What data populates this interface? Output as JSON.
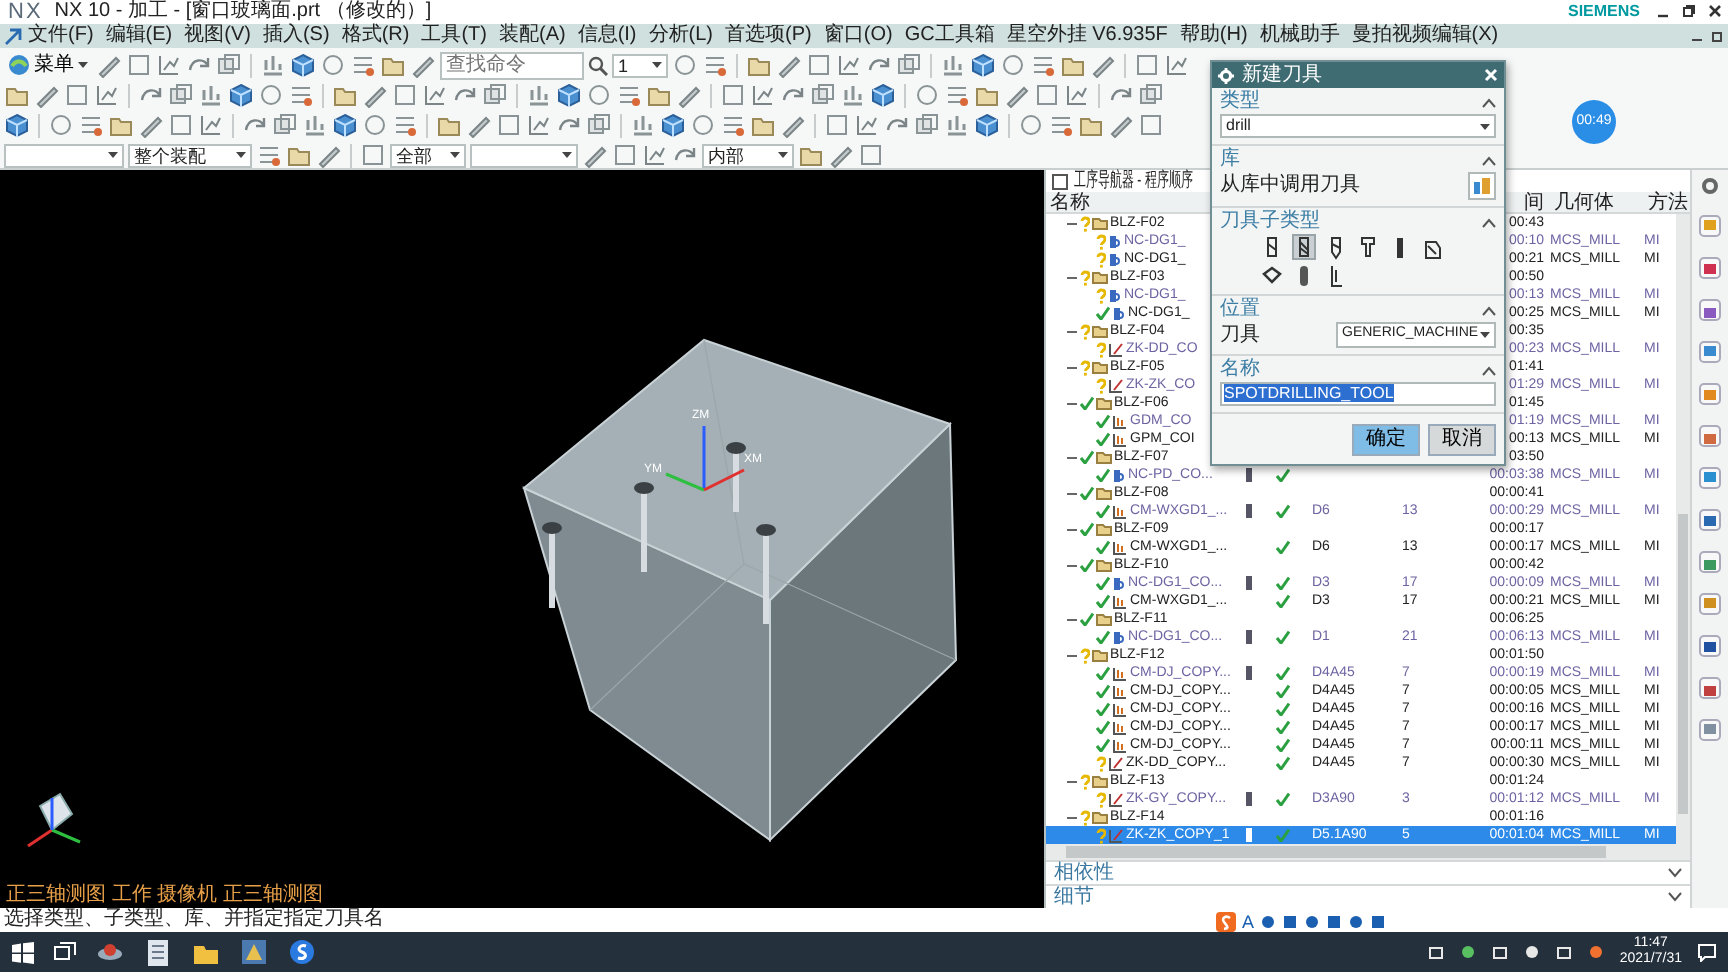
{
  "window": {
    "logo": "NX",
    "title": "NX 10 - 加工 - [窗口玻璃面.prt （修改的）]",
    "vendor": "SIEMENS"
  },
  "menu": [
    "文件(F)",
    "编辑(E)",
    "视图(V)",
    "插入(S)",
    "格式(R)",
    "工具(T)",
    "装配(A)",
    "信息(I)",
    "分析(L)",
    "首选项(P)",
    "窗口(O)",
    "GC工具箱",
    "星空外挂 V6.935F",
    "帮助(H)",
    "机械助手",
    "曼拍视频编辑(X)"
  ],
  "toolbar": {
    "menu_button": "菜单",
    "search_placeholder": "查找命令",
    "layer": "1"
  },
  "selection_bar": {
    "assembly_scope": "整个装配",
    "filter": "全部",
    "snap": "内部"
  },
  "timer": "00:49",
  "viewport": {
    "axis_labels": [
      "ZM",
      "YM",
      "XM"
    ],
    "view_label": "正三轴测图 工作 摄像机 正三轴测图"
  },
  "navigator": {
    "title": "工序导航器 - 程序顺序",
    "columns": {
      "name": "名称",
      "time": "间",
      "geometry": "几何体",
      "method": "方法"
    },
    "groups": [
      {
        "name": "BLZ-F02",
        "needs_regeneration": true,
        "time": "00:43",
        "expanded": true,
        "selected": false,
        "children": [
          {
            "kind": "nc",
            "name": "NC-DG1_",
            "needs_regeneration": true,
            "dimmed": true,
            "time": "00:10",
            "geometry": "MCS_MILL",
            "method": "MI",
            "selected": false
          },
          {
            "kind": "nc",
            "name": "NC-DG1_",
            "needs_regeneration": true,
            "dimmed": false,
            "time": "00:21",
            "geometry": "MCS_MILL",
            "method": "MI",
            "selected": false
          }
        ]
      },
      {
        "name": "BLZ-F03",
        "needs_regeneration": true,
        "time": "00:50",
        "expanded": true,
        "selected": false,
        "children": [
          {
            "kind": "nc",
            "name": "NC-DG1_",
            "needs_regeneration": true,
            "dimmed": true,
            "time": "00:13",
            "geometry": "MCS_MILL",
            "method": "MI",
            "selected": false
          },
          {
            "kind": "nc",
            "name": "NC-DG1_",
            "needs_regeneration": false,
            "dimmed": false,
            "time": "00:25",
            "geometry": "MCS_MILL",
            "method": "MI",
            "selected": false
          }
        ]
      },
      {
        "name": "BLZ-F04",
        "needs_regeneration": true,
        "time": "00:35",
        "expanded": true,
        "selected": false,
        "children": [
          {
            "kind": "drill",
            "name": "ZK-DD_CO",
            "needs_regeneration": true,
            "dimmed": true,
            "time": "00:23",
            "geometry": "MCS_MILL",
            "method": "MI",
            "selected": false
          }
        ]
      },
      {
        "name": "BLZ-F05",
        "needs_regeneration": true,
        "time": "01:41",
        "expanded": true,
        "selected": false,
        "children": [
          {
            "kind": "drill",
            "name": "ZK-ZK_CO",
            "needs_regeneration": true,
            "dimmed": true,
            "time": "01:29",
            "geometry": "MCS_MILL",
            "method": "MI",
            "selected": false
          }
        ]
      },
      {
        "name": "BLZ-F06",
        "needs_regeneration": false,
        "time": "01:45",
        "expanded": true,
        "selected": false,
        "children": [
          {
            "kind": "mill",
            "name": "GDM_CO",
            "needs_regeneration": false,
            "dimmed": true,
            "time": "01:19",
            "geometry": "MCS_MILL",
            "method": "MI",
            "selected": false
          },
          {
            "kind": "mill",
            "name": "GPM_COI",
            "needs_regeneration": false,
            "dimmed": false,
            "time": "00:13",
            "geometry": "MCS_MILL",
            "method": "MI",
            "selected": false
          }
        ]
      },
      {
        "name": "BLZ-F07",
        "needs_regeneration": false,
        "time": "03:50",
        "expanded": true,
        "selected": false,
        "children": [
          {
            "kind": "nc",
            "name": "NC-PD_CO...",
            "needs_regeneration": false,
            "dimmed": true,
            "tool_icon": true,
            "verified": true,
            "time": "00:03:38",
            "geometry": "MCS_MILL",
            "method": "MI",
            "selected": false
          }
        ]
      },
      {
        "name": "BLZ-F08",
        "needs_regeneration": false,
        "time": "00:00:41",
        "expanded": true,
        "selected": false,
        "children": [
          {
            "kind": "mill",
            "name": "CM-WXGD1_...",
            "needs_regeneration": false,
            "dimmed": true,
            "tool_icon": true,
            "verified": true,
            "tool": "D6",
            "count": "13",
            "time": "00:00:29",
            "geometry": "MCS_MILL",
            "method": "MI",
            "selected": false
          }
        ]
      },
      {
        "name": "BLZ-F09",
        "needs_regeneration": false,
        "time": "00:00:17",
        "expanded": true,
        "selected": false,
        "children": [
          {
            "kind": "mill",
            "name": "CM-WXGD1_...",
            "needs_regeneration": false,
            "dimmed": false,
            "tool_icon": false,
            "verified": true,
            "tool": "D6",
            "count": "13",
            "time": "00:00:17",
            "geometry": "MCS_MILL",
            "method": "MI",
            "selected": false
          }
        ]
      },
      {
        "name": "BLZ-F10",
        "needs_regeneration": false,
        "time": "00:00:42",
        "expanded": true,
        "selected": false,
        "children": [
          {
            "kind": "nc",
            "name": "NC-DG1_CO...",
            "needs_regeneration": false,
            "dimmed": true,
            "tool_icon": true,
            "verified": true,
            "tool": "D3",
            "count": "17",
            "time": "00:00:09",
            "geometry": "MCS_MILL",
            "method": "MI",
            "selected": false
          },
          {
            "kind": "mill",
            "name": "CM-WXGD1_...",
            "needs_regeneration": false,
            "dimmed": false,
            "tool_icon": false,
            "verified": true,
            "tool": "D3",
            "count": "17",
            "time": "00:00:21",
            "geometry": "MCS_MILL",
            "method": "MI",
            "selected": false
          }
        ]
      },
      {
        "name": "BLZ-F11",
        "needs_regeneration": false,
        "time": "00:06:25",
        "expanded": true,
        "selected": false,
        "children": [
          {
            "kind": "nc",
            "name": "NC-DG1_CO...",
            "needs_regeneration": false,
            "dimmed": true,
            "tool_icon": true,
            "verified": true,
            "tool": "D1",
            "count": "21",
            "time": "00:06:13",
            "geometry": "MCS_MILL",
            "method": "MI",
            "selected": false
          }
        ]
      },
      {
        "name": "BLZ-F12",
        "needs_regeneration": true,
        "time": "00:01:50",
        "expanded": true,
        "selected": false,
        "children": [
          {
            "kind": "mill",
            "name": "CM-DJ_COPY...",
            "needs_regeneration": false,
            "dimmed": true,
            "tool_icon": true,
            "verified": true,
            "tool": "D4A45",
            "count": "7",
            "time": "00:00:19",
            "geometry": "MCS_MILL",
            "method": "MI",
            "selected": false
          },
          {
            "kind": "mill",
            "name": "CM-DJ_COPY...",
            "needs_regeneration": false,
            "dimmed": false,
            "tool_icon": false,
            "verified": true,
            "tool": "D4A45",
            "count": "7",
            "time": "00:00:05",
            "geometry": "MCS_MILL",
            "method": "MI",
            "selected": false
          },
          {
            "kind": "mill",
            "name": "CM-DJ_COPY...",
            "needs_regeneration": false,
            "dimmed": false,
            "tool_icon": false,
            "verified": true,
            "tool": "D4A45",
            "count": "7",
            "time": "00:00:16",
            "geometry": "MCS_MILL",
            "method": "MI",
            "selected": false
          },
          {
            "kind": "mill",
            "name": "CM-DJ_COPY...",
            "needs_regeneration": false,
            "dimmed": false,
            "tool_icon": false,
            "verified": true,
            "tool": "D4A45",
            "count": "7",
            "time": "00:00:17",
            "geometry": "MCS_MILL",
            "method": "MI",
            "selected": false
          },
          {
            "kind": "mill",
            "name": "CM-DJ_COPY...",
            "needs_regeneration": false,
            "dimmed": false,
            "tool_icon": false,
            "verified": true,
            "tool": "D4A45",
            "count": "7",
            "time": "00:00:11",
            "geometry": "MCS_MILL",
            "method": "MI",
            "selected": false
          },
          {
            "kind": "drill",
            "name": "ZK-DD_COPY...",
            "needs_regeneration": true,
            "dimmed": false,
            "tool_icon": false,
            "verified": true,
            "tool": "D4A45",
            "count": "7",
            "time": "00:00:30",
            "geometry": "MCS_MILL",
            "method": "MI",
            "selected": false
          }
        ]
      },
      {
        "name": "BLZ-F13",
        "needs_regeneration": true,
        "time": "00:01:24",
        "expanded": true,
        "selected": false,
        "children": [
          {
            "kind": "drill",
            "name": "ZK-GY_COPY...",
            "needs_regeneration": true,
            "dimmed": true,
            "tool_icon": true,
            "verified": true,
            "tool": "D3A90",
            "count": "3",
            "time": "00:01:12",
            "geometry": "MCS_MILL",
            "method": "MI",
            "selected": false
          }
        ]
      },
      {
        "name": "BLZ-F14",
        "needs_regeneration": true,
        "time": "00:01:16",
        "expanded": true,
        "selected": false,
        "children": [
          {
            "kind": "drill",
            "name": "ZK-ZK_COPY_1",
            "needs_regeneration": true,
            "tool_icon": true,
            "verified": true,
            "tool": "D5.1A90",
            "count": "5",
            "time": "00:01:04",
            "geometry": "MCS_MILL",
            "method": "MI",
            "selected": true
          }
        ]
      }
    ]
  },
  "panels": [
    {
      "label": "相依性",
      "expanded": false
    },
    {
      "label": "细节",
      "expanded": false
    }
  ],
  "dialog": {
    "title": "新建刀具",
    "type": {
      "header": "类型",
      "expanded": true,
      "value": "drill"
    },
    "library": {
      "header": "库",
      "expanded": true,
      "label": "从库中调用刀具"
    },
    "subtypes": {
      "header": "刀具子类型",
      "expanded": true,
      "items": [
        {
          "selected": false
        },
        {
          "selected": true
        },
        {
          "selected": false
        },
        {
          "selected": false
        },
        {
          "selected": false
        },
        {
          "selected": false
        },
        {
          "selected": false
        },
        {
          "selected": false
        },
        {
          "selected": false
        }
      ]
    },
    "location": {
      "header": "位置",
      "expanded": true,
      "label": "刀具",
      "value": "GENERIC_MACHINE"
    },
    "name": {
      "header": "名称",
      "expanded": true,
      "value": "SPOTDRILLING_TOOL",
      "text_selected": true
    },
    "buttons": [
      {
        "label": "确定",
        "kind": "primary"
      },
      {
        "label": "取消",
        "kind": "secondary"
      }
    ]
  },
  "status_bar": {
    "prompt": "选择类型、子类型、库、并指定指定刀具名",
    "ime_label": "A"
  },
  "taskbar": {
    "time": "11:47",
    "date": "2021/7/31"
  }
}
